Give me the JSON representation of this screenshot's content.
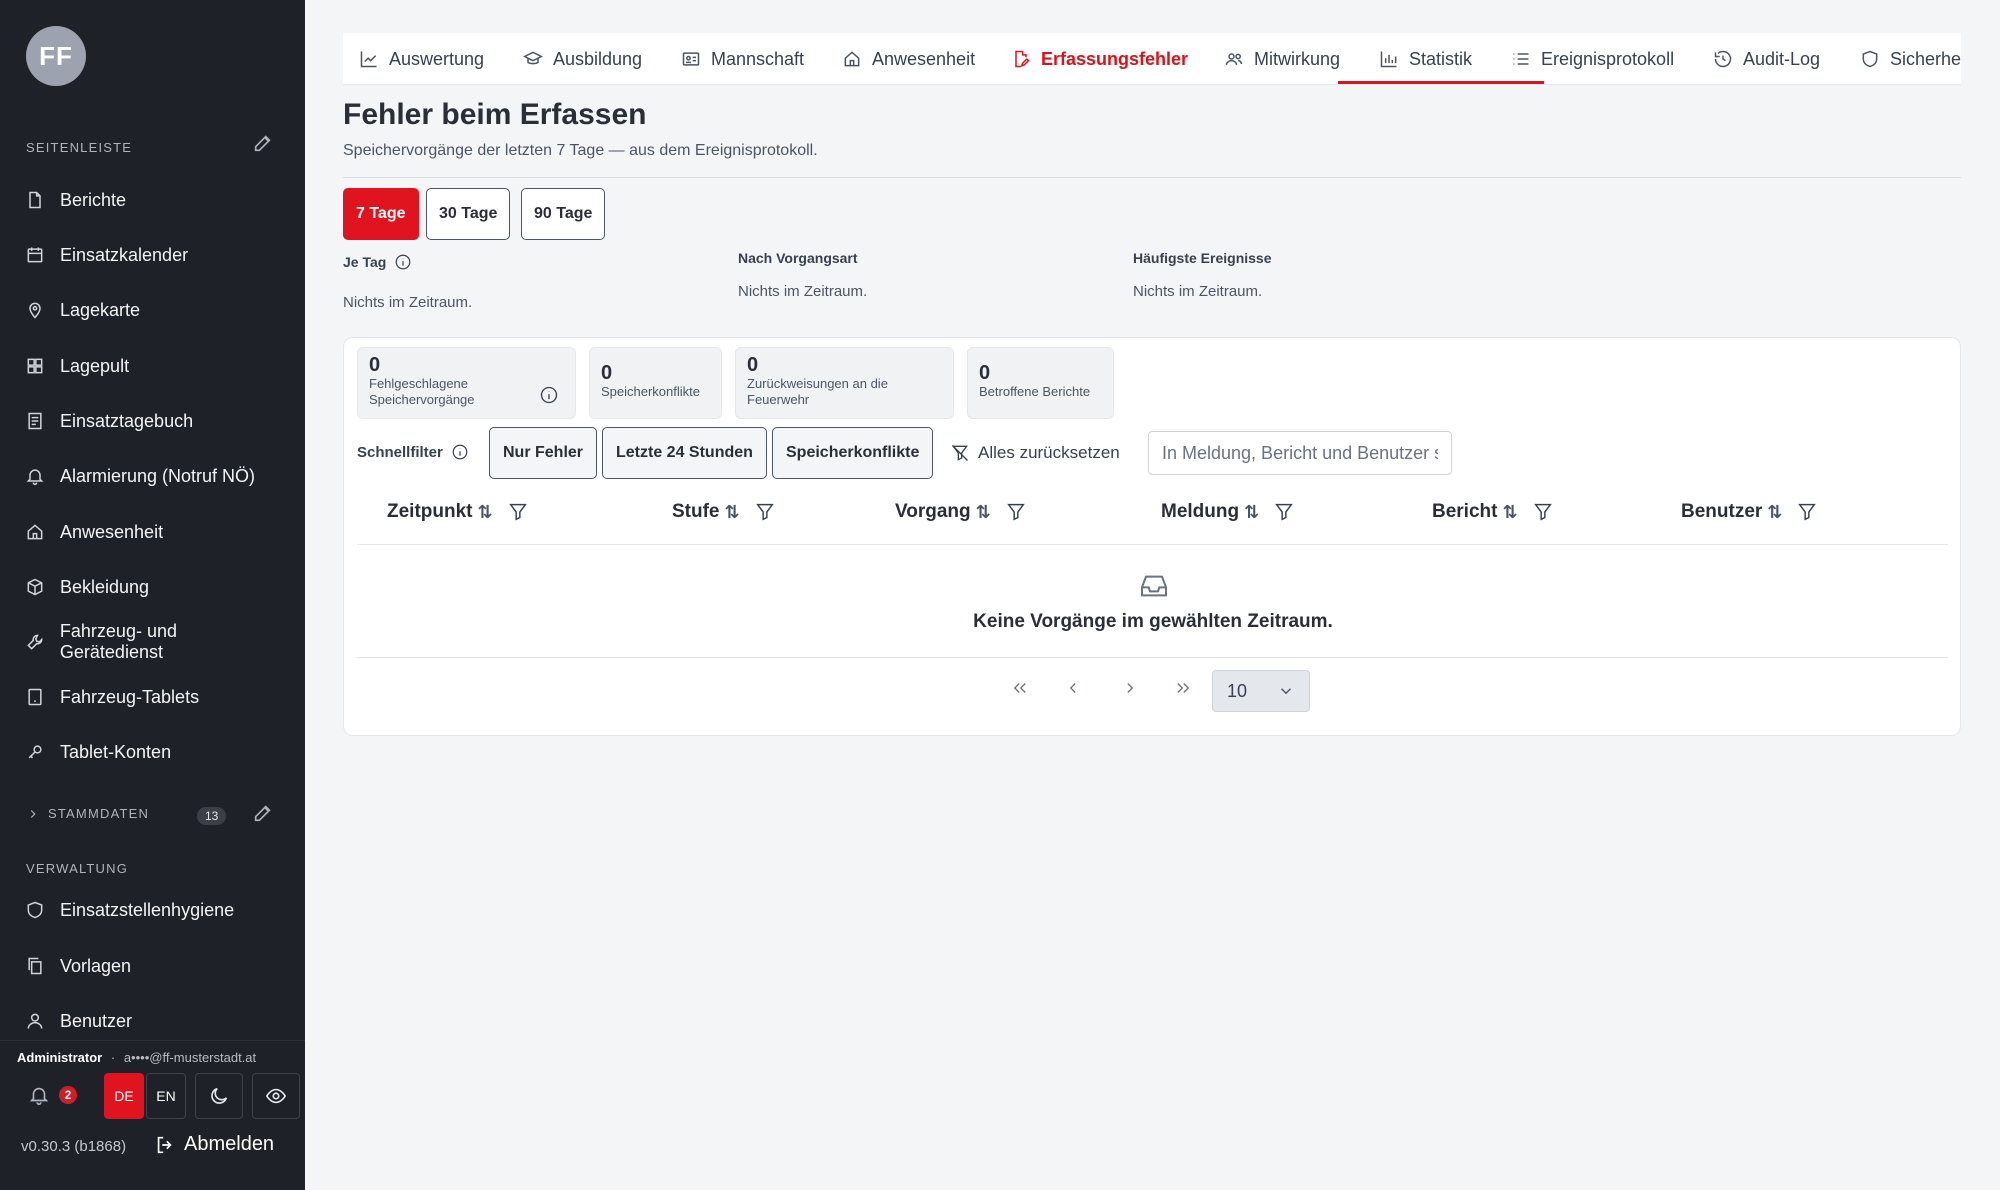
{
  "sidebar": {
    "avatar_initials": "FF",
    "section_sidebar": "SEITENLEISTE",
    "items": [
      {
        "label": "Berichte",
        "icon": "file-icon"
      },
      {
        "label": "Einsatzkalender",
        "icon": "calendar-icon"
      },
      {
        "label": "Lagekarte",
        "icon": "map-pin-icon"
      },
      {
        "label": "Lagepult",
        "icon": "grid-icon"
      },
      {
        "label": "Einsatztagebuch",
        "icon": "notebook-icon"
      },
      {
        "label": "Alarmierung (Notruf NÖ)",
        "icon": "bell-icon"
      },
      {
        "label": "Anwesenheit",
        "icon": "home-icon"
      },
      {
        "label": "Bekleidung",
        "icon": "box-icon"
      },
      {
        "label": "Fahrzeug- und Gerätedienst",
        "icon": "wrench-icon"
      },
      {
        "label": "Fahrzeug-Tablets",
        "icon": "tablet-icon"
      },
      {
        "label": "Tablet-Konten",
        "icon": "key-icon"
      }
    ],
    "section_stammdaten": "STAMMDATEN",
    "stammdaten_count": "13",
    "section_verwaltung": "VERWALTUNG",
    "admin_items": [
      {
        "label": "Einsatzstellenhygiene",
        "icon": "shield-icon"
      },
      {
        "label": "Vorlagen",
        "icon": "copy-icon"
      },
      {
        "label": "Benutzer",
        "icon": "user-icon"
      }
    ],
    "user_role": "Administrator",
    "user_sep": "·",
    "user_email": "a••••@ff-musterstadt.at",
    "notifications": "2",
    "lang_de": "DE",
    "lang_en": "EN",
    "version": "v0.30.3 (b1868)",
    "logout": "Abmelden"
  },
  "tabs": [
    {
      "label": "Auswertung",
      "icon": "chart-line-icon"
    },
    {
      "label": "Ausbildung",
      "icon": "graduation-cap-icon"
    },
    {
      "label": "Mannschaft",
      "icon": "id-card-icon"
    },
    {
      "label": "Anwesenheit",
      "icon": "home-icon"
    },
    {
      "label": "Erfassungsfehler",
      "icon": "file-edit-icon",
      "active": true
    },
    {
      "label": "Mitwirkung",
      "icon": "users-icon"
    },
    {
      "label": "Statistik",
      "icon": "bar-chart-icon"
    },
    {
      "label": "Ereignisprotokoll",
      "icon": "list-icon"
    },
    {
      "label": "Audit-Log",
      "icon": "history-icon"
    },
    {
      "label": "Sicherhei",
      "icon": "shield-icon"
    }
  ],
  "page": {
    "title": "Fehler beim Erfassen",
    "subtitle": "Speichervorgänge der letzten 7 Tage — aus dem Ereignisprotokoll.",
    "ranges": [
      "7 Tage",
      "30 Tage",
      "90 Tage"
    ],
    "active_range": "7 Tage"
  },
  "stats": {
    "per_day_label": "Je Tag",
    "per_day_value": "Nichts im Zeitraum.",
    "by_type_label": "Nach Vorgangsart",
    "by_type_value": "Nichts im Zeitraum.",
    "top_events_label": "Häufigste Ereignisse",
    "top_events_value": "Nichts im Zeitraum."
  },
  "kpis": [
    {
      "value": "0",
      "label": "Fehlgeschlagene Speichervorgänge"
    },
    {
      "value": "0",
      "label": "Speicherkonflikte"
    },
    {
      "value": "0",
      "label": "Zurückweisungen an die Feuerwehr"
    },
    {
      "value": "0",
      "label": "Betroffene Berichte"
    }
  ],
  "quickfilter": {
    "label": "Schnellfilter",
    "buttons": [
      "Nur Fehler",
      "Letzte 24 Stunden",
      "Speicherkonflikte"
    ],
    "reset": "Alles zurücksetzen",
    "search_placeholder": "In Meldung, Bericht und Benutzer suchen"
  },
  "table": {
    "columns": [
      "Zeitpunkt",
      "Stufe",
      "Vorgang",
      "Meldung",
      "Bericht",
      "Benutzer"
    ],
    "sort_glyph": "⇅",
    "empty_text": "Keine Vorgänge im gewählten Zeitraum.",
    "page_size": "10"
  }
}
